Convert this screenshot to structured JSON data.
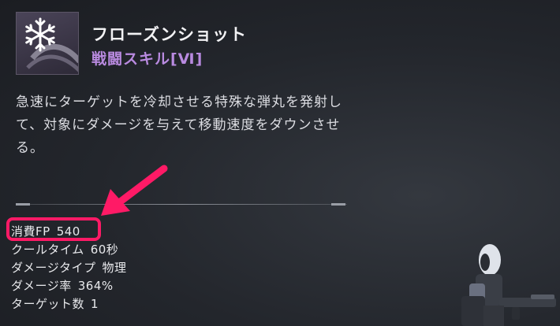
{
  "skill": {
    "name": "フローズンショット",
    "type": "戦闘スキル[Ⅵ]",
    "icon": "snowflake-icon",
    "description": "急速にターゲットを冷却させる特殊な弾丸を発射して、対象にダメージを与えて移動速度をダウンさせる。"
  },
  "stats": [
    {
      "label": "消費FP",
      "value": "540"
    },
    {
      "label": "クールタイム",
      "value": "60秒"
    },
    {
      "label": "ダメージタイプ",
      "value": "物理"
    },
    {
      "label": "ダメージ率",
      "value": "364%"
    },
    {
      "label": "ターゲット数",
      "value": "1"
    }
  ],
  "colors": {
    "skill_type": "#b98ae0",
    "highlight": "#ff1a66",
    "background": "#23262c"
  }
}
